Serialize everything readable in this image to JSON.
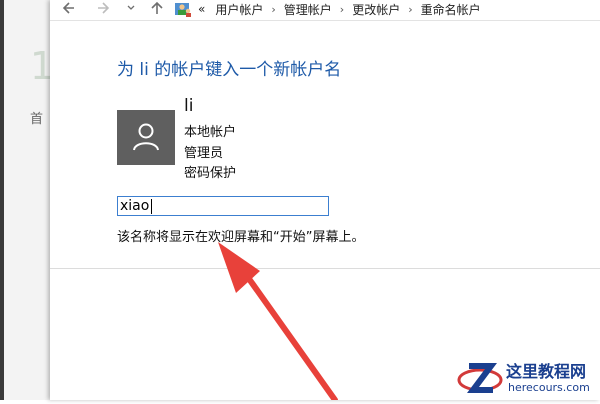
{
  "background": {
    "big_char": "1",
    "small_text": "首"
  },
  "nav": {
    "back_icon": "arrow-left-icon",
    "forward_icon": "arrow-right-icon",
    "history_icon": "chevron-down-icon",
    "up_icon": "arrow-up-icon",
    "location_icon": "user-accounts-icon",
    "overflow": "«",
    "breadcrumbs": [
      "用户帐户",
      "管理帐户",
      "更改帐户",
      "重命名帐户"
    ]
  },
  "page": {
    "title": "为 li 的帐户键入一个新帐户名",
    "account": {
      "name": "li",
      "details": [
        "本地帐户",
        "管理员",
        "密码保护"
      ],
      "avatar_icon": "user-icon"
    },
    "new_name_value": "xiao",
    "hint": "该名称将显示在欢迎屏幕和“开始”屏幕上。"
  },
  "annotation": {
    "arrow_color": "#e8413a"
  },
  "watermark": {
    "logo_icon": "z-logo-icon",
    "name": "这里教程网",
    "url": "herecours.com"
  }
}
